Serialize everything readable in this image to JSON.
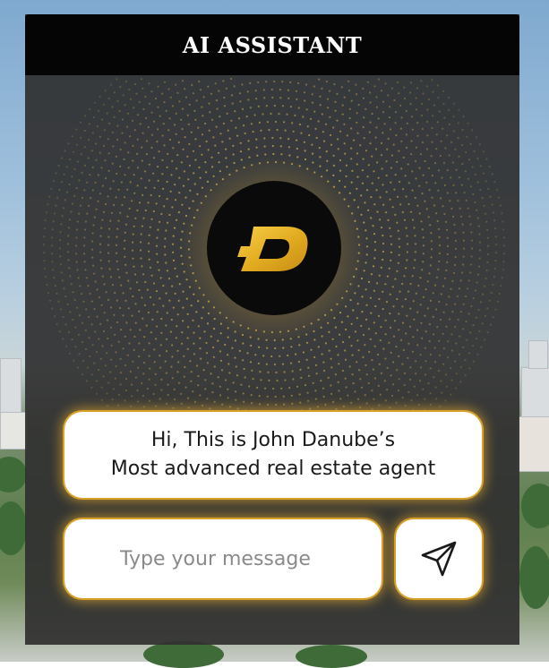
{
  "header": {
    "title": "AI ASSISTANT"
  },
  "logo": {
    "letter": "D",
    "icon": "danube-logo-icon",
    "colors": {
      "gold": "#e8b62a",
      "black": "#0a0a0a"
    }
  },
  "message": {
    "line1": "Hi, This is John Danube’s",
    "line2": "Most advanced real estate agent"
  },
  "composer": {
    "placeholder": "Type your message",
    "value": "",
    "send_icon": "send-icon"
  },
  "theme": {
    "accent_glow": "#d9a02a",
    "panel_bg": "#303030",
    "header_bg": "#050505"
  }
}
